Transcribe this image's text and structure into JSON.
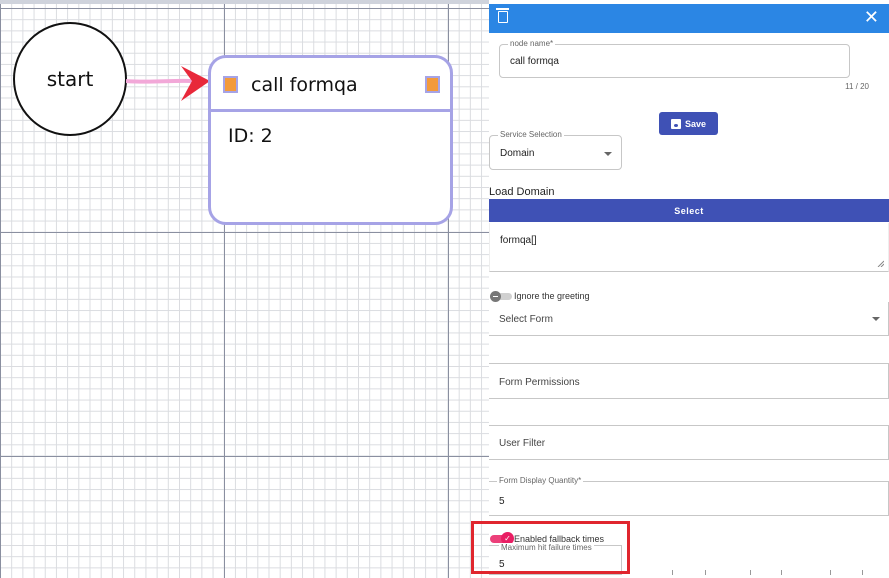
{
  "canvas": {
    "start_node": {
      "label": "start"
    },
    "call_node": {
      "title": "call formqa",
      "id_text": "ID: 2"
    }
  },
  "panel": {
    "icons": {
      "delete": "trash-icon",
      "close": "close-icon",
      "close_glyph": "✕"
    },
    "node_name": {
      "label": "node name*",
      "value": "call formqa",
      "counter": "11 / 20"
    },
    "save_label": "Save",
    "service_selection": {
      "label": "Service Selection",
      "value": "Domain"
    },
    "load_domain_label": "Load Domain",
    "select_label": "Select",
    "domain_text": "formqa[]",
    "ignore_greeting": {
      "label": "Ignore the greeting",
      "enabled": false
    },
    "select_form": {
      "placeholder": "Select Form"
    },
    "form_permissions": {
      "placeholder": "Form Permissions"
    },
    "user_filter": {
      "placeholder": "User Filter"
    },
    "form_display_quantity": {
      "label": "Form Display Quantity*",
      "value": "5"
    },
    "fallback": {
      "label": "Enabled fallback times",
      "enabled": true
    },
    "maximum_hit_failure": {
      "label": "Maximum hit failure times",
      "value": "5"
    }
  },
  "colors": {
    "panel_header": "#2b86e4",
    "primary_button": "#3f51b5",
    "node_border": "#a6a3e6",
    "port": "#f39a3b",
    "edge": "#f2a8d8",
    "arrow": "#e8283a",
    "toggle_on": "#e91e63",
    "highlight": "#e0262e"
  }
}
